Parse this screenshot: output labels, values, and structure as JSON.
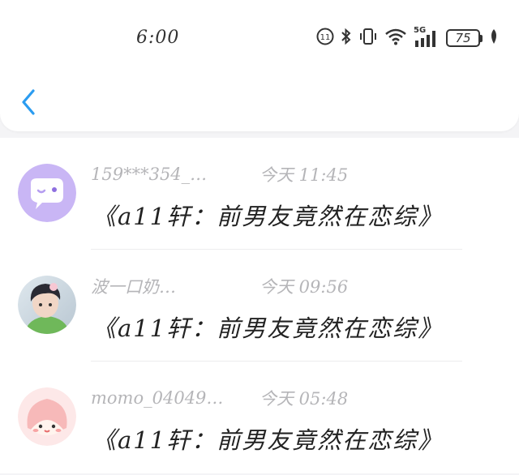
{
  "status_bar": {
    "time": "6:00",
    "battery": "75",
    "network": "5G",
    "icons": [
      "hd-badge-icon",
      "bluetooth-icon",
      "vibrate-icon",
      "wifi-icon",
      "signal-icon",
      "battery-icon",
      "leaf-icon"
    ]
  },
  "nav": {
    "back_icon": "chevron-left-icon"
  },
  "colors": {
    "accent": "#2b9cf0",
    "meta_text": "#b5b5b8",
    "message_text": "#222222"
  },
  "comments": [
    {
      "username": "159***354_…",
      "time": "今天 11:45",
      "message": "《a11轩：前男友竟然在恋综》",
      "avatar": "purple-chat-bubble-avatar"
    },
    {
      "username": "波一口奶…",
      "time": "今天 09:56",
      "message": "《a11轩：前男友竟然在恋综》",
      "avatar": "photo-avatar"
    },
    {
      "username": "momo_04049…",
      "time": "今天 05:48",
      "message": "《a11轩：前男友竟然在恋综》",
      "avatar": "peach-character-avatar"
    }
  ]
}
